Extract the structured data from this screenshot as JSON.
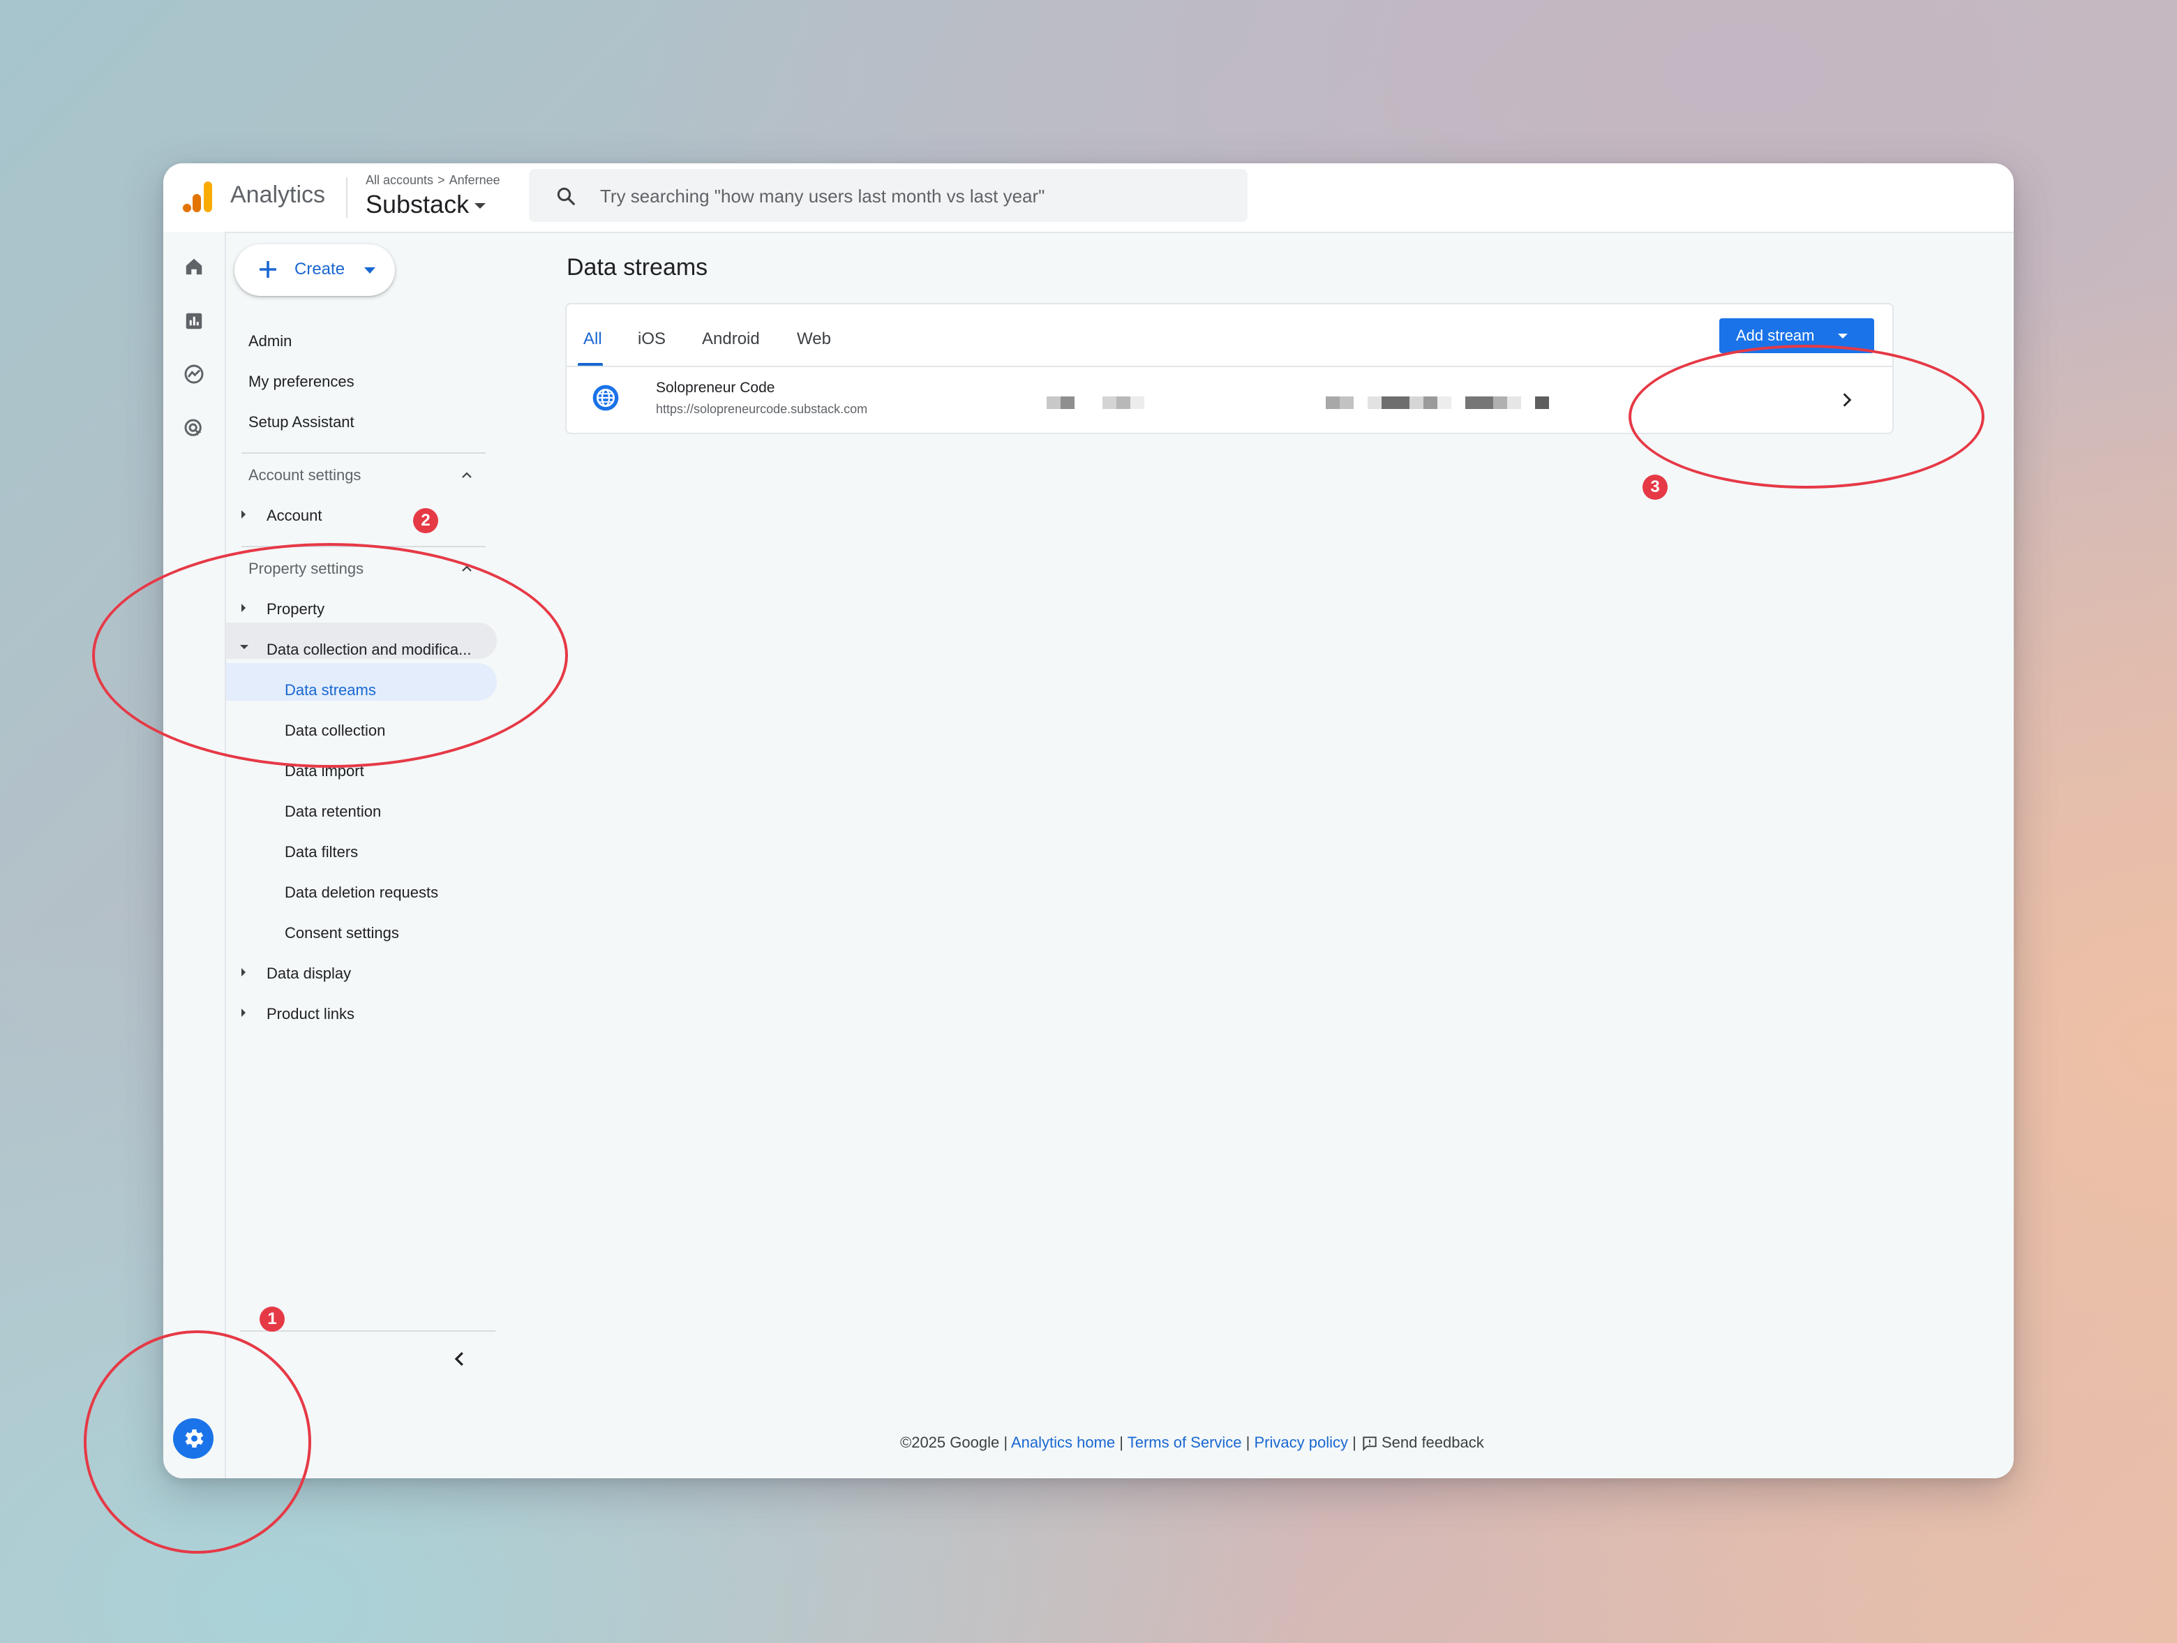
{
  "topbar": {
    "app_name": "Analytics",
    "breadcrumb": {
      "root": "All accounts",
      "account": "Anfernee"
    },
    "property_name": "Substack",
    "search_placeholder": "Try searching \"how many users last month vs last year\""
  },
  "sidebar": {
    "create_label": "Create",
    "items": {
      "admin": "Admin",
      "my_preferences": "My preferences",
      "setup_assistant": "Setup Assistant"
    },
    "account_settings": {
      "title": "Account settings",
      "account": "Account"
    },
    "property_settings": {
      "title": "Property settings",
      "property": "Property",
      "data_collection_group": "Data collection and modifica...",
      "children": [
        "Data streams",
        "Data collection",
        "Data import",
        "Data retention",
        "Data filters",
        "Data deletion requests",
        "Consent settings"
      ],
      "active_child": "Data streams",
      "data_display": "Data display",
      "product_links": "Product links"
    }
  },
  "main": {
    "title": "Data streams",
    "tabs": [
      "All",
      "iOS",
      "Android",
      "Web"
    ],
    "active_tab": "All",
    "add_stream_label": "Add stream",
    "streams": [
      {
        "name": "Solopreneur Code",
        "url": "https://solopreneurcode.substack.com"
      }
    ]
  },
  "footer": {
    "copyright": "©2025 Google |",
    "analytics_home": "Analytics home",
    "sep1": "|",
    "terms": "Terms of Service",
    "sep2": "|",
    "privacy": "Privacy policy",
    "sep3": "|",
    "feedback": "Send feedback"
  },
  "annotations": [
    "1",
    "2",
    "3"
  ],
  "colors": {
    "accent": "#1a73e8",
    "link": "#1967d2",
    "annotation_red": "#e63946",
    "selected_bg": "#e3edfc"
  },
  "icons": [
    "analytics-logo-icon",
    "search-icon",
    "home-icon",
    "reports-icon",
    "explore-icon",
    "advertising-icon",
    "admin-gear-icon",
    "plus-icon",
    "globe-icon",
    "chevron-right-icon",
    "collapse-chevron-icon",
    "feedback-icon"
  ]
}
